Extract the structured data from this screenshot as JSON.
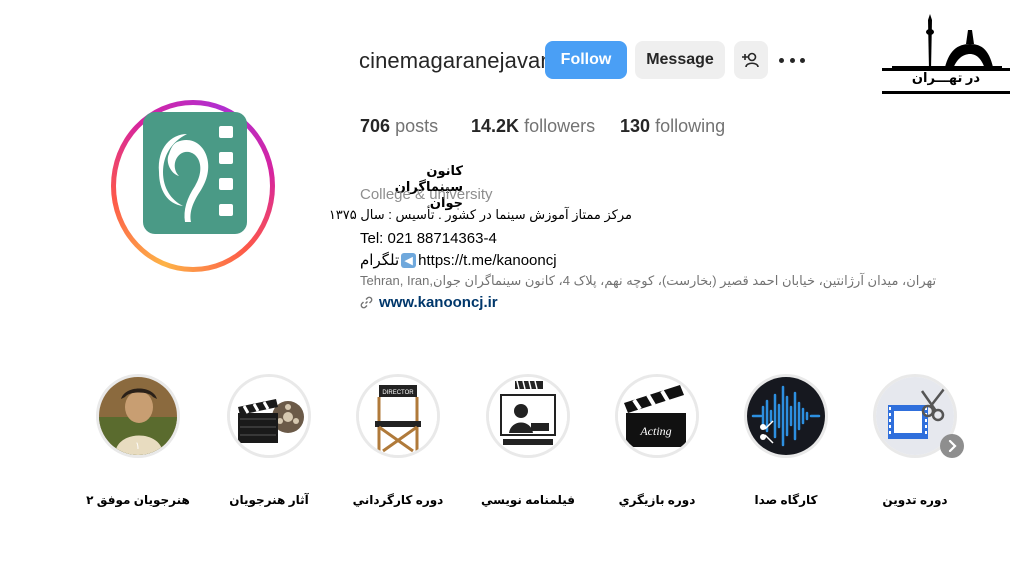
{
  "profile": {
    "username": "cinemagaranejavan",
    "follow_label": "Follow",
    "message_label": "Message",
    "suggest_icon": "person-add-icon",
    "more_icon": "more-horizontal-icon"
  },
  "stats": {
    "posts_count": "706",
    "posts_label": "posts",
    "followers_count": "14.2K",
    "followers_label": "followers",
    "following_count": "130",
    "following_label": "following"
  },
  "bio": {
    "name": "کانون سینماگران جوان",
    "category": "College & university",
    "description": "مرکز ممتاز آموزش سینما در کشور . تأسیس : سال   ۱۳۷۵",
    "tel": "Tel: 021 88714363-4",
    "telegram_url": "https://t.me/kanooncj",
    "telegram_label": "تلگرام",
    "address_en": "Tehran, Iran",
    "address_fa": "تهران، میدان آرژانتین، خیابان احمد قصیر (بخارست)، کوچه نهم، پلاک 4، کانون سینماگران جوان",
    "link": "www.kanooncj.ir"
  },
  "watermark": {
    "text": "در تهـــران"
  },
  "highlights": [
    {
      "label": "هنرجويان موفق ۲",
      "icon": "portrait-photo"
    },
    {
      "label": "آثار هنرجويان",
      "icon": "film-reel-clapper-icon"
    },
    {
      "label": "دوره كارگرداني",
      "icon": "director-chair-icon"
    },
    {
      "label": "فيلمنامه نويسي",
      "icon": "typewriter-writer-icon"
    },
    {
      "label": "دوره بازيگري",
      "icon": "acting-clapper-icon"
    },
    {
      "label": "كارگاه صدا",
      "icon": "sound-wave-icon"
    },
    {
      "label": "دوره تدوين",
      "icon": "scissors-film-icon"
    }
  ],
  "colors": {
    "follow_button": "#4a9ff5",
    "secondary_button": "#efefef",
    "logo_green": "#4a9a86",
    "link": "#00376b"
  }
}
